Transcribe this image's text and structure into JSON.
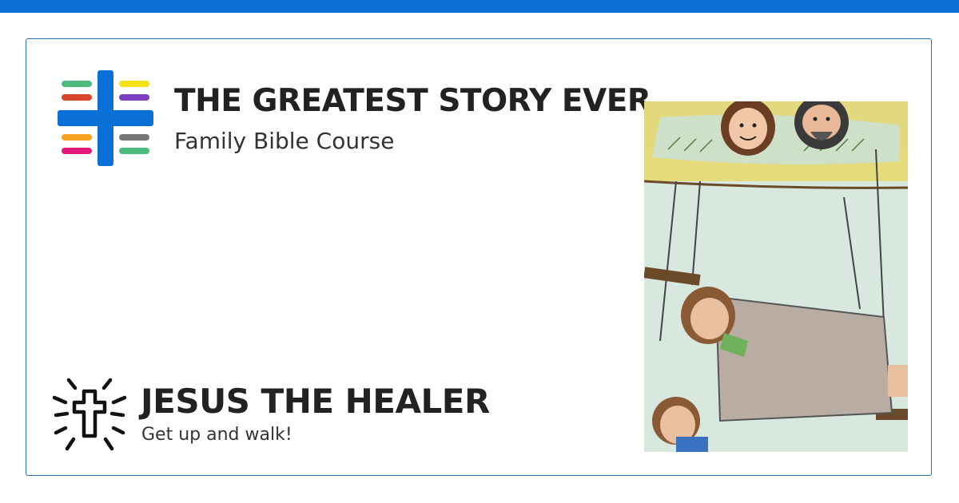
{
  "colors": {
    "top_bar": "#0a6fd6",
    "card_border": "#2a6fb0",
    "logo_blue": "#0a6fd6",
    "logo_bars": [
      "#4cbb7f",
      "#d9472b",
      "#f5e11a",
      "#7b3fbf",
      "#f5a21e",
      "#e2187a",
      "#777777",
      "#4cbb7f"
    ]
  },
  "brand": {
    "title": "THE GREATEST STORY EVER",
    "subtitle": "Family Bible Course",
    "logo_icon": "cross-logo-icon"
  },
  "lesson": {
    "title": "JESUS THE HEALER",
    "subtitle": "Get up and walk!",
    "icon": "radiant-cross-icon"
  },
  "illustration": {
    "description_icon": "paralytic-lowered-through-roof-illustration"
  }
}
